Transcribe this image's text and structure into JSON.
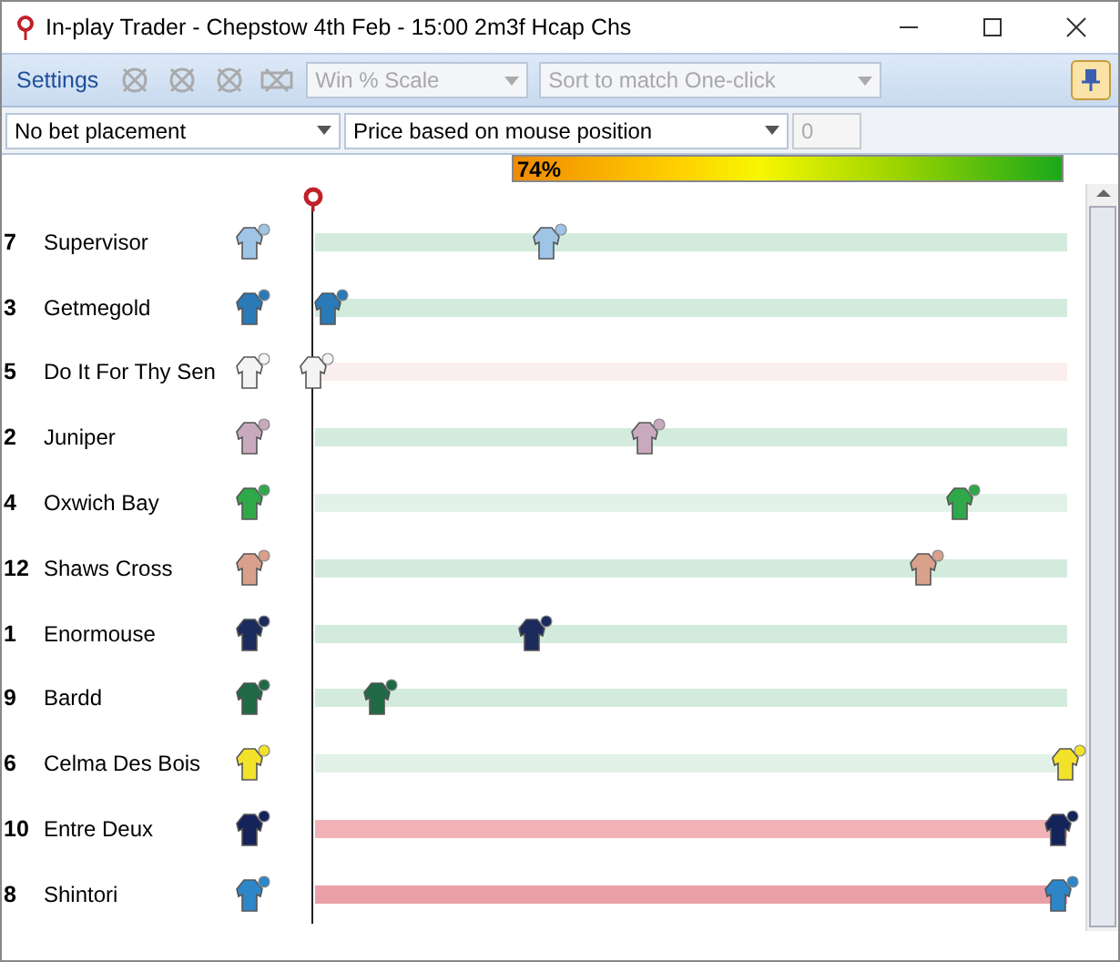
{
  "window": {
    "title": "In-play Trader - Chepstow 4th Feb - 15:00 2m3f Hcap Chs"
  },
  "toolbar": {
    "settings": "Settings",
    "scale": {
      "value": "Win % Scale",
      "disabled": true
    },
    "sort": {
      "value": "Sort to match One-click",
      "disabled": true
    }
  },
  "options": {
    "bet": "No bet placement",
    "price": "Price based on mouse position",
    "amount": {
      "value": "0",
      "disabled": true
    }
  },
  "progress": {
    "label": "74%"
  },
  "runners": [
    {
      "number": "7",
      "name": "Supervisor",
      "color": "#d3ebdc",
      "level": 0.31
    },
    {
      "number": "3",
      "name": "Getmegold",
      "color": "#d3ebdc",
      "level": 0.02
    },
    {
      "number": "5",
      "name": "Do It For Thy Sen",
      "color": "#fbeeee",
      "level": 0.0
    },
    {
      "number": "2",
      "name": "Juniper",
      "color": "#d3ebdc",
      "level": 0.44
    },
    {
      "number": "4",
      "name": "Oxwich Bay",
      "color": "#e3f2e8",
      "level": 0.86
    },
    {
      "number": "12",
      "name": "Shaws Cross",
      "color": "#d3ebdc",
      "level": 0.81
    },
    {
      "number": "1",
      "name": "Enormouse",
      "color": "#d3ebdc",
      "level": 0.29
    },
    {
      "number": "9",
      "name": "Bardd",
      "color": "#d3ebdc",
      "level": 0.085
    },
    {
      "number": "6",
      "name": "Celma Des Bois",
      "color": "#e3f2e8",
      "level": 1.0
    },
    {
      "number": "10",
      "name": "Entre Deux",
      "color": "#f2b3b8",
      "level": 0.99
    },
    {
      "number": "8",
      "name": "Shintori",
      "color": "#eaa0a8",
      "level": 0.99
    }
  ]
}
